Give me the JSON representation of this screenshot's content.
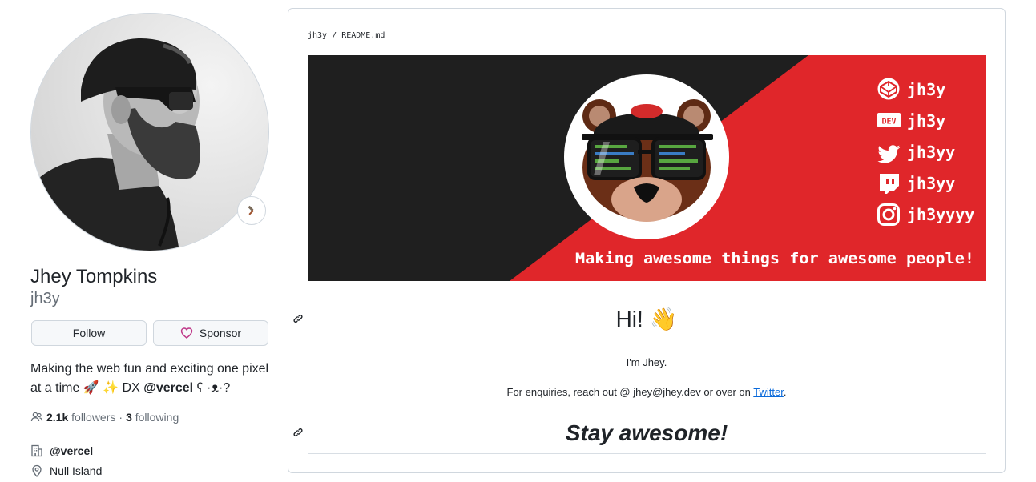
{
  "profile": {
    "name": "Jhey Tompkins",
    "username": "jh3y",
    "follow_label": "Follow",
    "sponsor_label": "Sponsor",
    "bio_text": "Making the web fun and exciting one pixel at a time 🚀 ✨ DX",
    "bio_handle": "@vercel",
    "bio_tail": "ʕ ·ᴥ·?",
    "followers_count": "2.1k",
    "followers_label": "followers",
    "separator": "·",
    "following_count": "3",
    "following_label": "following",
    "organization": "@vercel",
    "location": "Null Island"
  },
  "readme": {
    "breadcrumb_user": "jh3y",
    "breadcrumb_sep": "/",
    "breadcrumb_file": "README",
    "breadcrumb_ext": ".md",
    "banner": {
      "handles": [
        "jh3y",
        "jh3y",
        "jh3yy",
        "jh3yy",
        "jh3yyyy"
      ],
      "icons": [
        "codepen-icon",
        "dev-icon",
        "twitter-icon",
        "twitch-icon",
        "instagram-icon"
      ],
      "dev_badge": "DEV",
      "tagline": "Making awesome things for awesome people!",
      "colors": {
        "dark": "#1f1f1f",
        "red": "#e0262a",
        "white": "#ffffff"
      }
    },
    "heading": "Hi! 👋",
    "intro": "I'm Jhey.",
    "enquiry_text": "For enquiries, reach out @ jhey@jhey.dev or over on",
    "twitter_link": "Twitter",
    "enquiry_end": ".",
    "closing": "Stay awesome!"
  },
  "colors": {
    "link": "#0969da",
    "muted": "#656d76",
    "sponsor_heart": "#bf3989"
  }
}
